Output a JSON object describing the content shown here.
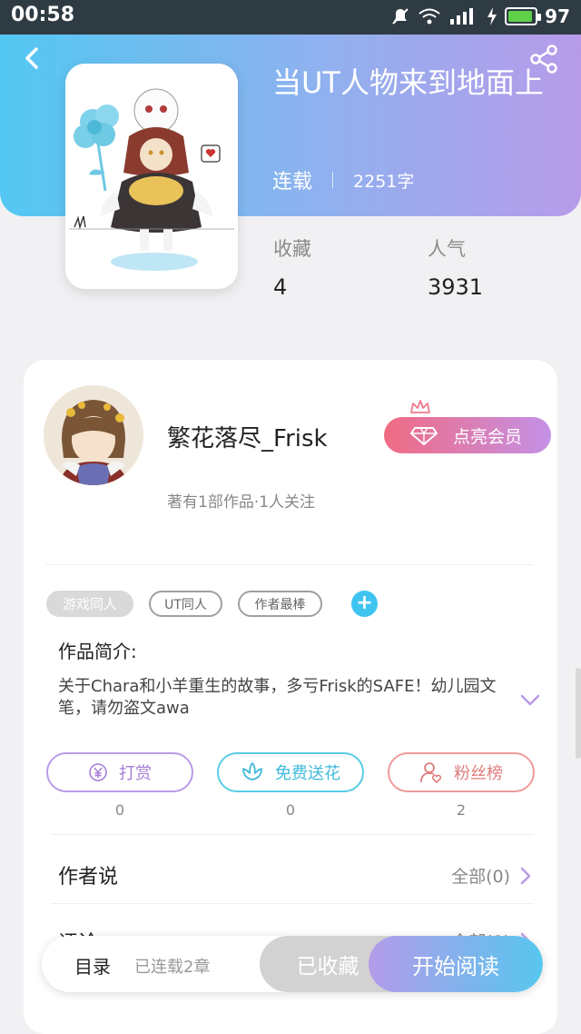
{
  "status_bar": {
    "time": "00:58",
    "network": "wifi 4G",
    "battery": "97"
  },
  "book": {
    "title": "当UT人物来到地面上",
    "status": "连载",
    "word_count": "2251字",
    "cover_description": "cover-illustration",
    "stats": [
      {
        "label": "收藏",
        "value": "4"
      },
      {
        "label": "人气",
        "value": "3931"
      }
    ]
  },
  "author": {
    "name": "繁花落尽_Frisk",
    "info": "著有1部作品·1人关注",
    "vip_label": "点亮会员"
  },
  "tags": [
    {
      "label": "游戏同人"
    },
    {
      "label": "UT同人"
    },
    {
      "label": "作者最棒"
    }
  ],
  "intro": {
    "title": "作品简介:",
    "text": "关于Chara和小羊重生的故事，多亏Frisk的SAFE！幼儿园文笔，请勿盗文awa"
  },
  "actions": [
    {
      "label": "打赏",
      "count": "0",
      "icon": "yen-icon"
    },
    {
      "label": "免费送花",
      "count": "0",
      "icon": "flower-icon"
    },
    {
      "label": "粉丝榜",
      "count": "2",
      "icon": "fans-icon"
    }
  ],
  "sections": {
    "author_says": {
      "title": "作者说",
      "right": "全部(0)"
    },
    "comments": {
      "title": "评论",
      "right": "全部(0)"
    }
  },
  "bottom_bar": {
    "toc": "目录",
    "chapters": "已连载2章",
    "collected": "已收藏",
    "read": "开始阅读"
  },
  "colors": {
    "header_gradient_start": "#53c8f2",
    "header_gradient_end": "#b79be9",
    "vip_gradient_start": "#f06b83",
    "vip_gradient_end": "#c491e6",
    "accent_blue": "#3fc4f0",
    "accent_purple": "#b39be9"
  }
}
